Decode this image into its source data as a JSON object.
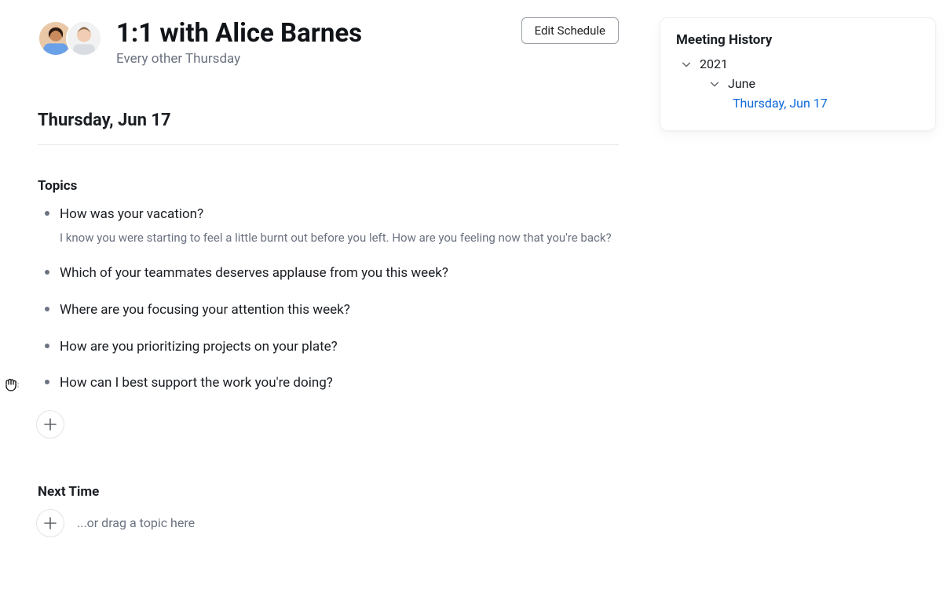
{
  "header": {
    "title": "1:1 with Alice Barnes",
    "subtitle": "Every other Thursday",
    "edit_button": "Edit Schedule"
  },
  "meeting": {
    "date_heading": "Thursday, Jun 17",
    "topics_heading": "Topics",
    "topics": [
      {
        "title": "How was your vacation?",
        "note": "I know you were starting to feel a little burnt out before you left. How are you feeling now that you're back?"
      },
      {
        "title": "Which of your teammates deserves applause from you this week?"
      },
      {
        "title": "Where are you focusing your attention this week?"
      },
      {
        "title": "How are you prioritizing projects on your plate?"
      },
      {
        "title": "How can I best support the work you're doing?"
      }
    ],
    "next_time_heading": "Next Time",
    "drag_placeholder": "...or drag a topic here"
  },
  "history": {
    "heading": "Meeting History",
    "year": "2021",
    "month": "June",
    "entry": "Thursday, Jun 17"
  }
}
